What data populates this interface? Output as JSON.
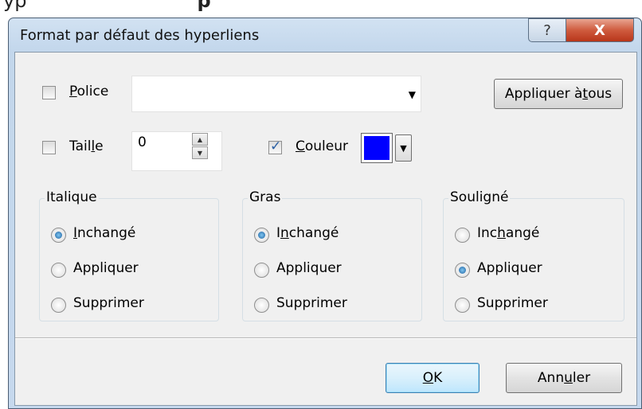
{
  "background": {
    "text_left": "yp",
    "text_bold": "p"
  },
  "dialog": {
    "title": "Format par défaut des hyperliens",
    "help_glyph": "?",
    "close_glyph": "X"
  },
  "font": {
    "label": "Police",
    "mnemonic": "P",
    "label_rest": "olice",
    "checked": false,
    "value": "",
    "dropdown_glyph": "▼"
  },
  "apply_all": {
    "label_before": "Appliquer à ",
    "mnemonic": "t",
    "label_after": "ous"
  },
  "size": {
    "label_before": "Tail",
    "mnemonic": "l",
    "label_after": "e",
    "checked": false,
    "value": "0",
    "up_glyph": "▲",
    "down_glyph": "▼"
  },
  "color": {
    "mnemonic": "C",
    "label_rest": "ouleur",
    "checked": true,
    "check_glyph": "✓",
    "swatch_color": "#0000ff",
    "dropdown_glyph": "▼"
  },
  "groups": [
    {
      "title": "Italique",
      "options": [
        {
          "pre": "",
          "mnemonic": "I",
          "post": "nchangé",
          "selected": true
        },
        {
          "pre": "Appliquer",
          "mnemonic": "",
          "post": "",
          "selected": false
        },
        {
          "pre": "Supprimer",
          "mnemonic": "",
          "post": "",
          "selected": false
        }
      ]
    },
    {
      "title": "Gras",
      "options": [
        {
          "pre": "I",
          "mnemonic": "n",
          "post": "changé",
          "selected": true
        },
        {
          "pre": "Appliquer",
          "mnemonic": "",
          "post": "",
          "selected": false
        },
        {
          "pre": "Supprimer",
          "mnemonic": "",
          "post": "",
          "selected": false
        }
      ]
    },
    {
      "title": "Souligné",
      "options": [
        {
          "pre": "Inc",
          "mnemonic": "h",
          "post": "angé",
          "selected": false
        },
        {
          "pre": "Appliquer",
          "mnemonic": "",
          "post": "",
          "selected": true
        },
        {
          "pre": "Supprimer",
          "mnemonic": "",
          "post": "",
          "selected": false
        }
      ]
    }
  ],
  "buttons": {
    "ok": {
      "mnemonic": "O",
      "rest": "K"
    },
    "cancel": {
      "pre": "Ann",
      "mnemonic": "u",
      "post": "ler"
    }
  }
}
